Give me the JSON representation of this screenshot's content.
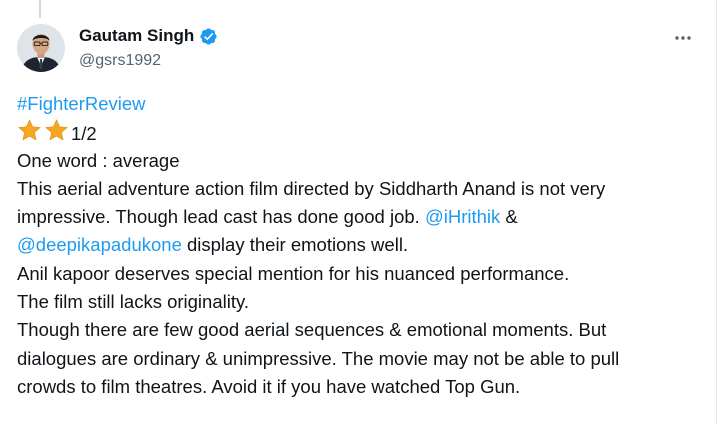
{
  "author": {
    "name": "Gautam Singh",
    "handle": "@gsrs1992",
    "verified": true,
    "avatar_icon": "person-photo"
  },
  "colors": {
    "link": "#1d9bf0",
    "verified_badge": "#1d9bf0",
    "text": "#0f1419",
    "muted": "#536471",
    "star": "#f5a623"
  },
  "menu": {
    "more_icon": "ellipsis-icon"
  },
  "tweet": {
    "hashtag": "#FighterReview",
    "rating": {
      "stars_icon_count": 2,
      "suffix": "1/2"
    },
    "line_one_word": "One word : average",
    "line_3": "This aerial adventure action film directed by Siddharth Anand is not very",
    "line_4_text": "impressive. Though lead cast has done  good job. ",
    "mention_1": "@iHrithik",
    "amp": " & ",
    "mention_2": "@deepikapadukone",
    "line_5_text": " display their emotions well.",
    "line_6": "Anil kapoor deserves special mention for his nuanced performance.",
    "line_7": "The film still lacks originality.",
    "line_8": "Though there are few good aerial sequences &  emotional moments. But",
    "line_9": "dialogues are ordinary & unimpressive. The movie may not be able to pull",
    "line_10": "crowds to film theatres. Avoid it if you have watched Top Gun."
  }
}
